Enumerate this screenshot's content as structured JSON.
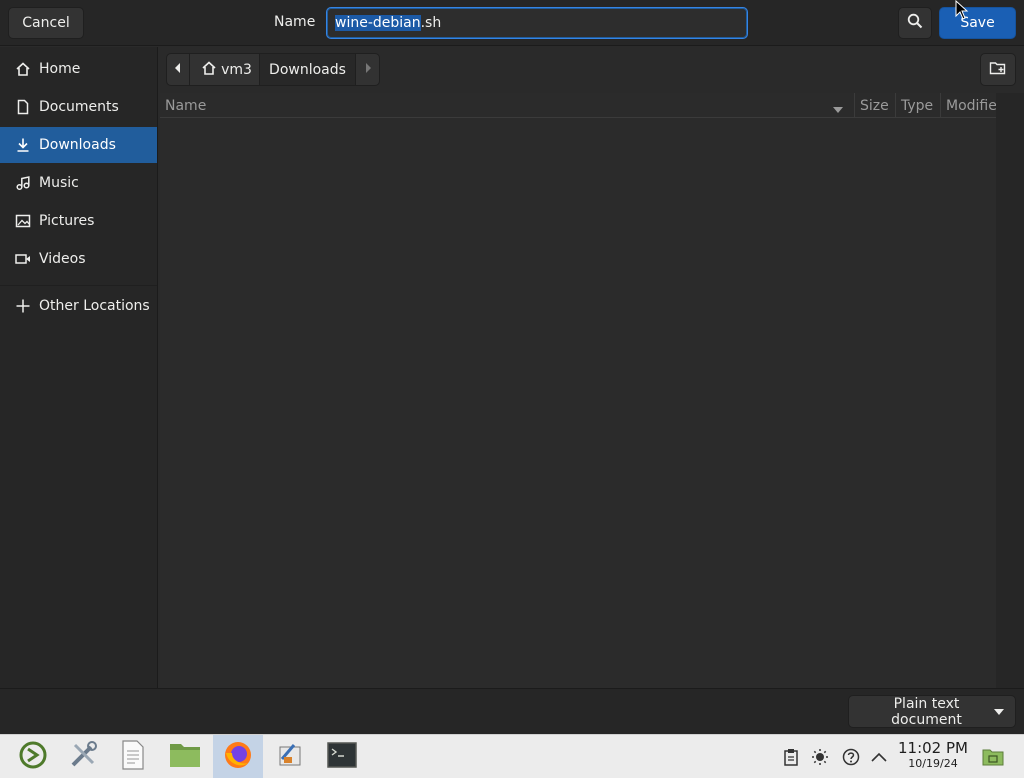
{
  "header": {
    "cancel_label": "Cancel",
    "name_label": "Name",
    "filename_selected": "wine-debian",
    "filename_rest": ".sh",
    "search_icon": "search-icon",
    "save_label": "Save"
  },
  "sidebar": {
    "items": [
      {
        "label": "Home",
        "icon": "home-icon"
      },
      {
        "label": "Documents",
        "icon": "document-icon"
      },
      {
        "label": "Downloads",
        "icon": "download-icon",
        "active": true
      },
      {
        "label": "Music",
        "icon": "music-icon"
      },
      {
        "label": "Pictures",
        "icon": "picture-icon"
      },
      {
        "label": "Videos",
        "icon": "video-icon"
      },
      {
        "label": "Other Locations",
        "icon": "plus-icon"
      }
    ]
  },
  "pathbar": {
    "home_label": "vm3",
    "current_label": "Downloads"
  },
  "filelist": {
    "columns": [
      "Name",
      "Size",
      "Type",
      "Modified"
    ],
    "sort_column": "Name",
    "rows": []
  },
  "footer": {
    "filter_label": "Plain text document"
  },
  "taskbar": {
    "apps": [
      "menu-icon",
      "settings-tools-icon",
      "text-editor-icon",
      "file-manager-icon",
      "firefox-icon",
      "installer-icon",
      "terminal-icon"
    ],
    "active_app": "firefox-icon",
    "time": "11:02 PM",
    "date": "10/19/24"
  },
  "colors": {
    "accent": "#1a5fb4",
    "sidebar_active": "#215d9c",
    "background": "#2b2b2b",
    "taskbar": "#ececec"
  }
}
